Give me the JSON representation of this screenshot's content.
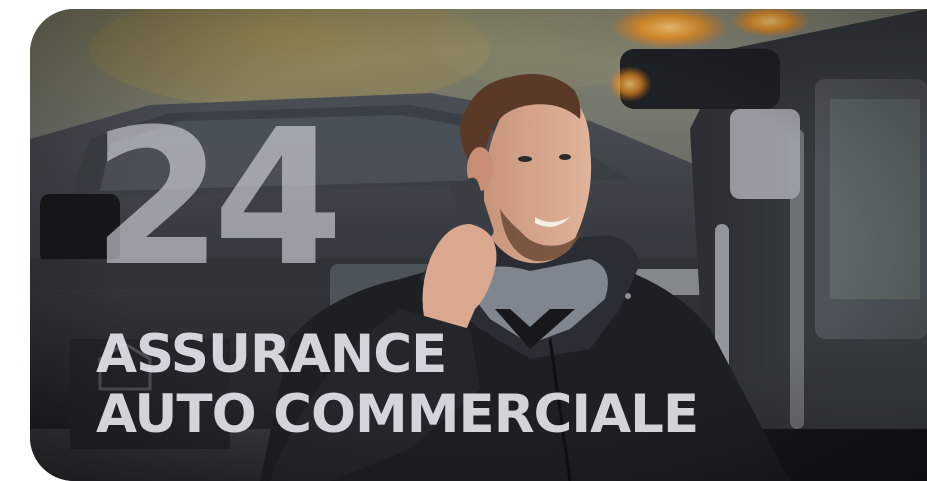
{
  "badge": {
    "number": "24"
  },
  "headline": {
    "line1": "ASSURANCE",
    "line2": "AUTO COMMERCIALE"
  },
  "colors": {
    "text_light": "#e6e9ee",
    "number_tint": "#d6dae0",
    "jacket": "#1c1f24",
    "hood_lining": "#7f8690",
    "beacon": "#ff9a1f"
  },
  "photo_subject": "man-on-phone-in-front-of-tow-truck"
}
